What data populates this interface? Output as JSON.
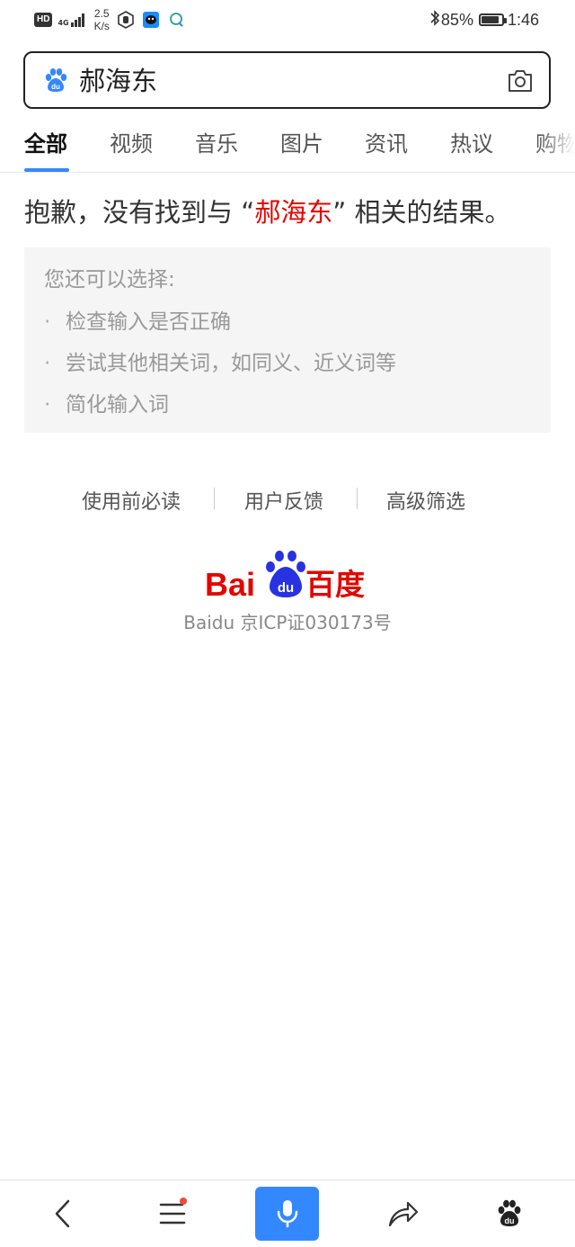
{
  "status_bar": {
    "hd": "HD",
    "network": "4G",
    "speed_value": "2.5",
    "speed_unit": "K/s",
    "battery": "85%",
    "battery_level": 0.85,
    "time": "1:46"
  },
  "search": {
    "query": "郝海东"
  },
  "tabs": [
    {
      "label": "全部",
      "active": true
    },
    {
      "label": "视频",
      "active": false
    },
    {
      "label": "音乐",
      "active": false
    },
    {
      "label": "图片",
      "active": false
    },
    {
      "label": "资讯",
      "active": false
    },
    {
      "label": "热议",
      "active": false
    },
    {
      "label": "购物",
      "active": false
    }
  ],
  "no_result": {
    "prefix": "抱歉，没有找到与 “",
    "keyword": "郝海东",
    "suffix": "” 相关的结果。"
  },
  "suggestions": {
    "title": "您还可以选择:",
    "bullet": "·",
    "items": [
      "检查输入是否正确",
      "尝试其他相关词，如同义、近义词等",
      "简化输入词"
    ]
  },
  "footer_links": [
    "使用前必读",
    "用户反馈",
    "高级筛选"
  ],
  "logo": {
    "latin": "Bai",
    "paw_text": "du",
    "chinese": "百度"
  },
  "icp": "Baidu 京ICP证030173号",
  "colors": {
    "accent": "#3388ff",
    "keyword_red": "#e10601",
    "logo_red": "#e10601",
    "logo_blue": "#2932e1"
  },
  "bottom_nav": {
    "back": "back-icon",
    "menu": "menu-icon",
    "voice": "mic-icon",
    "share": "share-icon",
    "home": "baidu-paw-icon"
  }
}
